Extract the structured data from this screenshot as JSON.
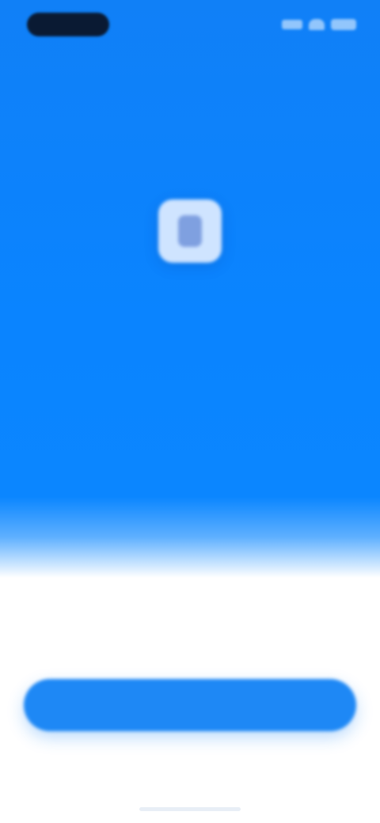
{
  "status_bar": {
    "time_pill": "",
    "icons": [
      "signal-icon",
      "wifi-icon",
      "battery-icon"
    ]
  },
  "hero": {
    "app_icon": "app-logo-icon",
    "title": "",
    "subtitle": ""
  },
  "actions": {
    "primary_label": "",
    "secondary_label": ""
  },
  "colors": {
    "accent": "#0a84ff",
    "button": "#1e88f5",
    "background": "#ffffff",
    "muted_text": "#8a9bb0"
  }
}
